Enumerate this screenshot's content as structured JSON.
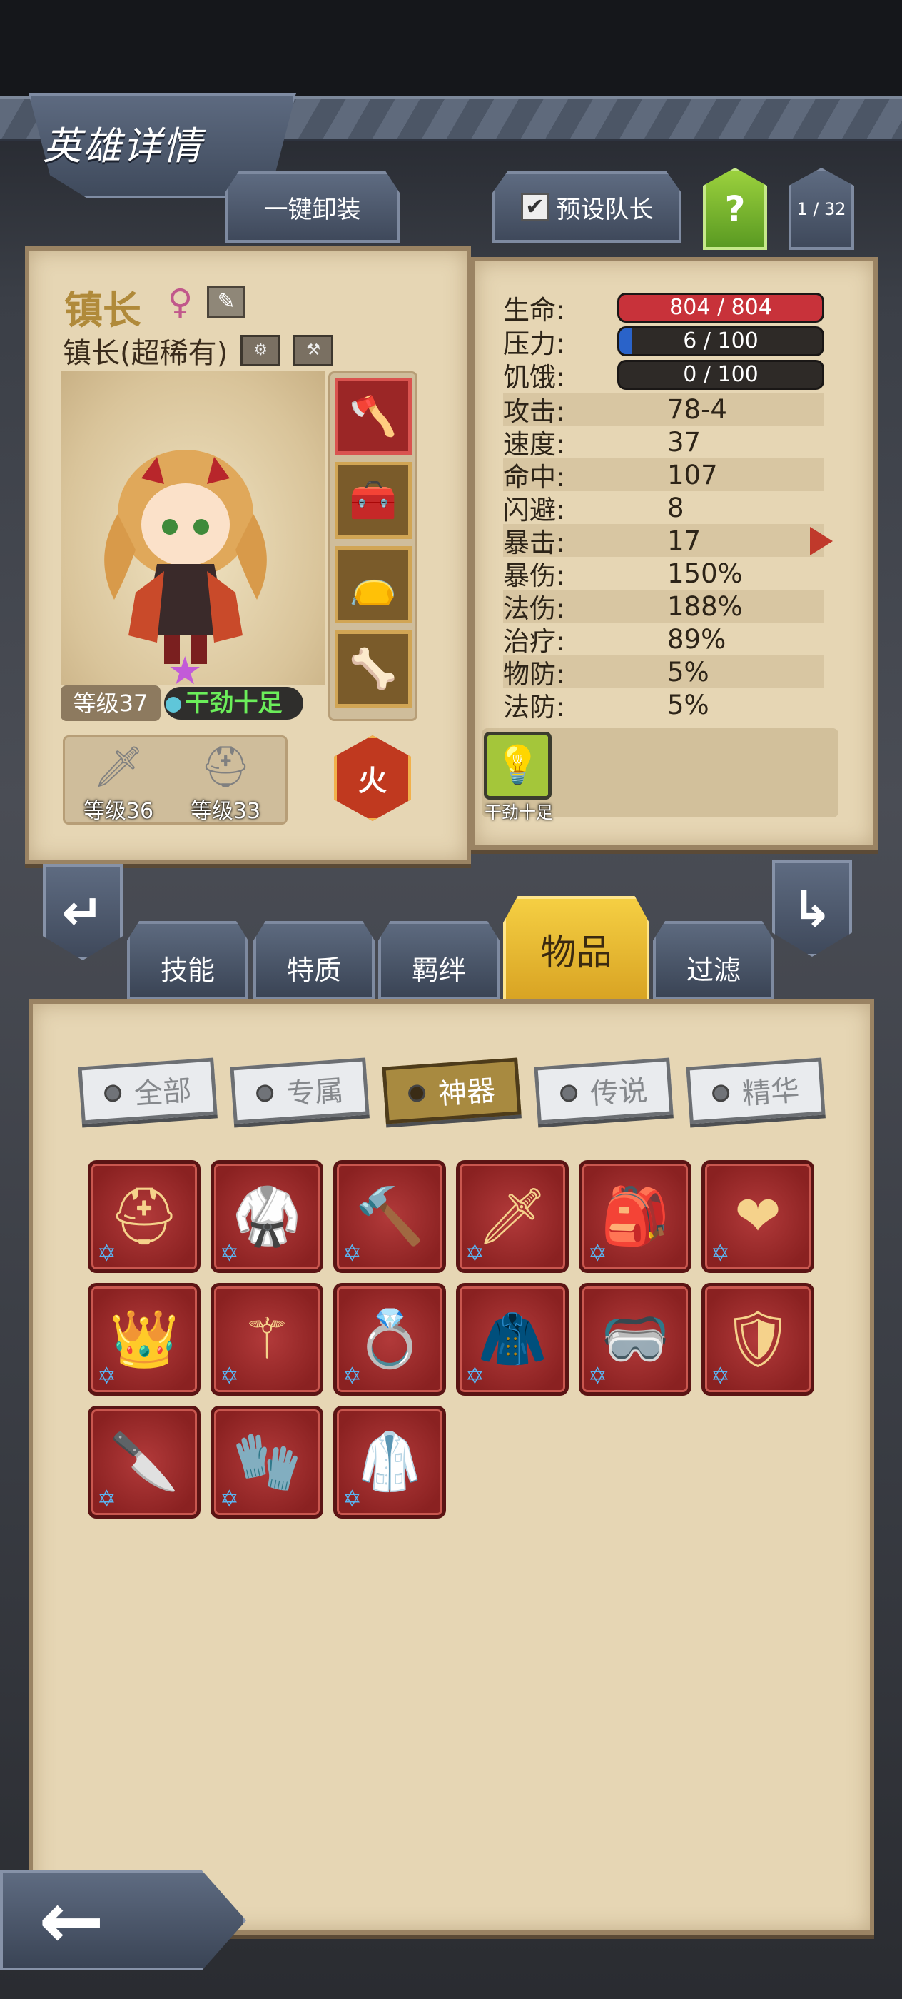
{
  "header": {
    "title": "英雄详情"
  },
  "top_buttons": {
    "unequip_all": "一键卸装",
    "preset_captain": "预设队长",
    "help": "?",
    "page_indicator": "1 / 32"
  },
  "hero": {
    "name": "镇长",
    "gender_symbol": "♀",
    "class": "镇长(超稀有)",
    "level": "等级37",
    "mood": "干劲十足",
    "element": "火",
    "weapon_level": "等级36",
    "armor_level": "等级33",
    "equipment_slot_count": 4
  },
  "stats": {
    "health": {
      "label": "生命:",
      "value": "804 / 804",
      "fill": 1.0
    },
    "stress": {
      "label": "压力:",
      "value": "6 / 100",
      "fill": 0.06
    },
    "hunger": {
      "label": "饥饿:",
      "value": "0 / 100",
      "fill": 0.0
    },
    "rows": [
      {
        "label": "攻击:",
        "value": "78-4"
      },
      {
        "label": "速度:",
        "value": "37"
      },
      {
        "label": "命中:",
        "value": "107"
      },
      {
        "label": "闪避:",
        "value": "8"
      },
      {
        "label": "暴击:",
        "value": "17"
      },
      {
        "label": "暴伤:",
        "value": "150%"
      },
      {
        "label": "法伤:",
        "value": "188%"
      },
      {
        "label": "治疗:",
        "value": "89%"
      },
      {
        "label": "物防:",
        "value": "5%"
      },
      {
        "label": "法防:",
        "value": "5%"
      }
    ],
    "trait_label": "干劲十足"
  },
  "tabs": [
    {
      "label": "技能"
    },
    {
      "label": "特质"
    },
    {
      "label": "羁绊"
    },
    {
      "label": "物品",
      "active": true
    },
    {
      "label": "过滤"
    }
  ],
  "filters": [
    {
      "label": "全部"
    },
    {
      "label": "专属"
    },
    {
      "label": "神器",
      "active": true
    },
    {
      "label": "传说"
    },
    {
      "label": "精华"
    }
  ],
  "items": [
    {
      "icon": "hood-icon"
    },
    {
      "icon": "armor-icon"
    },
    {
      "icon": "hammer-icon"
    },
    {
      "icon": "sword-icon"
    },
    {
      "icon": "backpack-icon"
    },
    {
      "icon": "heart-icon"
    },
    {
      "icon": "crown-icon"
    },
    {
      "icon": "staff-icon"
    },
    {
      "icon": "ring-icon"
    },
    {
      "icon": "cloak-icon"
    },
    {
      "icon": "goggles-icon"
    },
    {
      "icon": "helmet-icon"
    },
    {
      "icon": "dagger-icon"
    },
    {
      "icon": "gauntlet-icon"
    },
    {
      "icon": "coat-icon"
    }
  ],
  "colors": {
    "accent_gold": "#d8a323",
    "health_bar": "#c8323a",
    "stress_bar": "#2a63c9",
    "mood_text": "#6bee5a"
  }
}
